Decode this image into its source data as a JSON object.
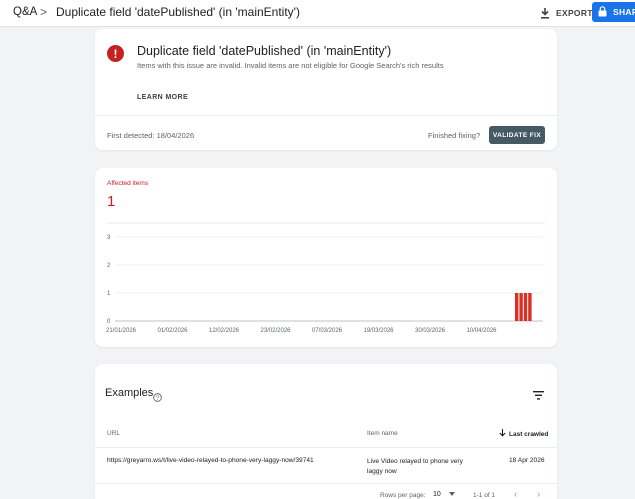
{
  "header": {
    "breadcrumb_root": "Q&A",
    "breadcrumb_sep": ">",
    "title": "Duplicate field 'datePublished' (in 'mainEntity')",
    "export_label": "EXPORT",
    "share_label": "SHARE",
    "accent_color": "#1a73e8"
  },
  "issue": {
    "icon": "error-icon",
    "title": "Duplicate field 'datePublished' (in 'mainEntity')",
    "description": "Items with this issue are invalid. Invalid items are not eligible for Google Search's rich results",
    "learn_more": "LEARN MORE",
    "first_detected": "First detected: 18/04/2026",
    "finished_fixing": "Finished fixing?",
    "validate_fix": "VALIDATE FIX",
    "error_color": "#c5221f"
  },
  "chart": {
    "affected_label": "Affected items",
    "affected_count": "1"
  },
  "chart_data": {
    "type": "bar",
    "title": "",
    "xlabel": "",
    "ylabel": "",
    "ylim": [
      0,
      3
    ],
    "yticks": [
      "3",
      "2",
      "1",
      "0"
    ],
    "x_tick_labels": [
      "21/01/2026",
      "01/02/2026",
      "12/02/2026",
      "23/02/2026",
      "07/03/2026",
      "19/03/2026",
      "30/03/2026",
      "10/04/2026"
    ],
    "series": [
      {
        "values": [
          1,
          1,
          1,
          1
        ]
      }
    ],
    "bar_color": "#d93025",
    "grid": true
  },
  "examples": {
    "title": "Examples",
    "columns": {
      "url": "URL",
      "item_name": "Item name",
      "last_crawled": "Last crawled"
    },
    "rows": [
      {
        "url": "https://greyarro.ws/t/live-video-relayed-to-phone-very-laggy-now/39741",
        "item_name": "Live Video relayed to phone very laggy now",
        "last_crawled": "18 Apr 2026"
      }
    ],
    "rows_per_page_label": "Rows per page:",
    "rows_per_page": "10",
    "pager_text": "1-1 of 1"
  }
}
